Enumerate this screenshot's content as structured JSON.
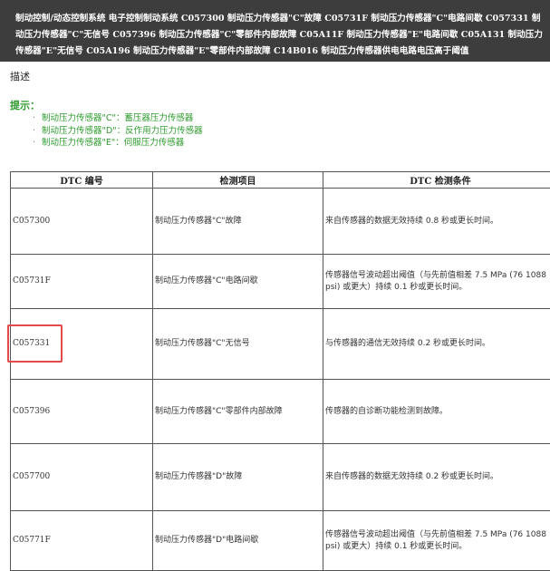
{
  "header": {
    "breadcrumb": "制动控制/动态控制系统 电子控制制动系统 C057300 制动压力传感器\"C\"故障 C05731F 制动压力传感器\"C\"电路间歇 C057331 制动压力传感器\"C\"无信号 C057396 制动压力传感器\"C\"零部件内部故障 C05A11F 制动压力传感器\"E\"电路间歇 C05A131 制动压力传感器\"E\"无信号 C05A196 制动压力传感器\"E\"零部件内部故障 C14B016 制动压力传感器供电电路电压高于阈值"
  },
  "description_label": "描述",
  "hint": {
    "title": "提示：",
    "items": [
      "制动压力传感器\"C\"：蓄压器压力传感器",
      "制动压力传感器\"D\"：反作用力压力传感器",
      "制动压力传感器\"E\"：伺服压力传感器"
    ]
  },
  "table": {
    "headers": [
      "DTC 编号",
      "检测项目",
      "DTC 检测条件"
    ],
    "rows": [
      {
        "code": "C057300",
        "item": "制动压力传感器\"C\"故障",
        "condition": "来自传感器的数据无效持续 0.8 秒或更长时间。"
      },
      {
        "code": "C05731F",
        "item": "制动压力传感器\"C\"电路间歇",
        "condition": "传感器信号波动超出阈值（与先前值相差 7.5 MPa (76 1088 psi) 或更大）持续 0.1 秒或更长时间。"
      },
      {
        "code": "C057331",
        "item": "制动压力传感器\"C\"无信号",
        "condition": "与传感器的通信无效持续 0.2 秒或更长时间。"
      },
      {
        "code": "C057396",
        "item": "制动压力传感器\"C\"零部件内部故障",
        "condition": "传感器的自诊断功能检测到故障。"
      },
      {
        "code": "C057700",
        "item": "制动压力传感器\"D\"故障",
        "condition": "来自传感器的数据无效持续 0.2 秒或更长时间。"
      },
      {
        "code": "C05771F",
        "item": "制动压力传感器\"D\"电路间歇",
        "condition": "传感器信号波动超出阈值（与先前值相差 7.5 MPa (76 1088 psi) 或更大）持续 0.1 秒或更长时间。"
      }
    ]
  },
  "colors": {
    "header_bg": "#3d3d3d",
    "hint": "#2e9a2e",
    "highlight": "#e34b4b"
  }
}
